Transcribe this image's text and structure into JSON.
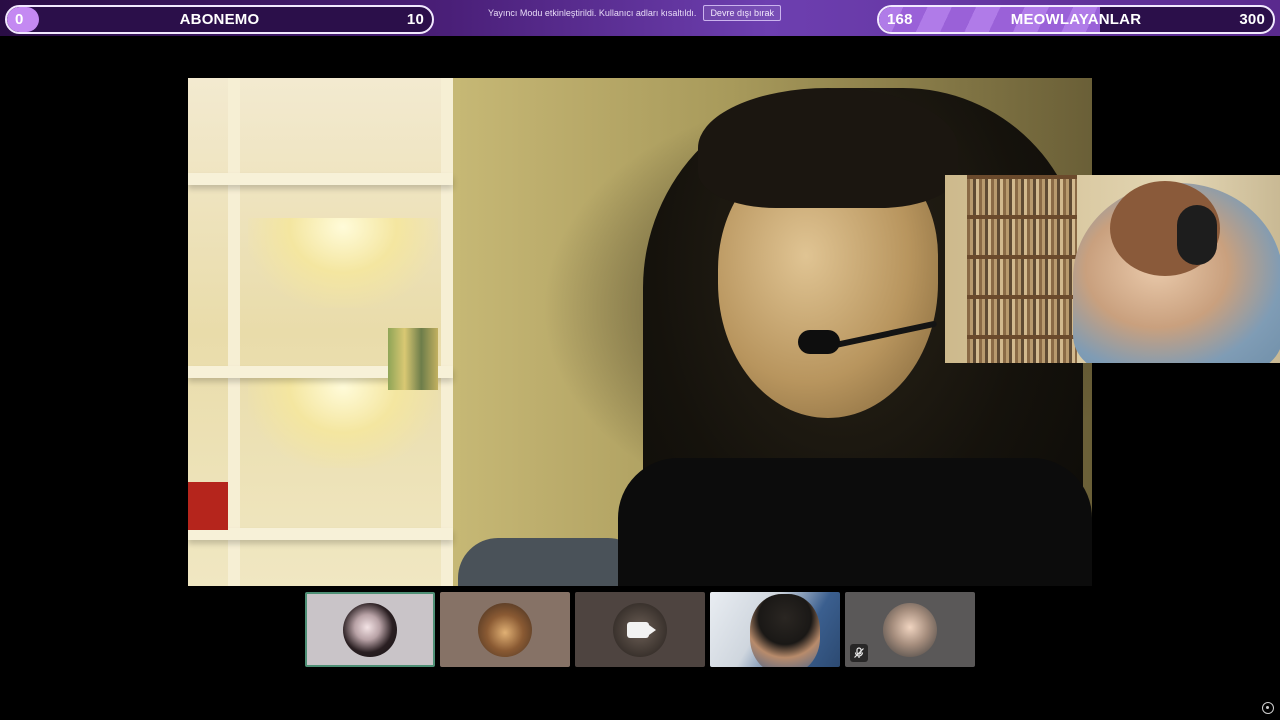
{
  "goals": {
    "left": {
      "current": "0",
      "label": "ABONEMO",
      "target": "10",
      "progress": 0.0
    },
    "right": {
      "current": "168",
      "label": "MEOWLAYANLAR",
      "target": "300",
      "progress": 0.56
    }
  },
  "streamer_mode": {
    "message": "Yayıncı Modu etkinleştirildi. Kullanıcı adları kısaltıldı.",
    "disable_label": "Devre dışı bırak"
  },
  "colors": {
    "topbar_accent": "#6d3fb0",
    "goal_fill": "#b07be8",
    "active_thumb_border": "#4d8f75"
  },
  "participants": [
    {
      "icon": "avatar",
      "active": true
    },
    {
      "icon": "avatar",
      "active": false
    },
    {
      "icon": "camera-icon",
      "active": false
    },
    {
      "icon": "video-feed",
      "active": false
    },
    {
      "icon": "avatar",
      "active": false,
      "status_icon": "mic-muted-icon"
    }
  ]
}
